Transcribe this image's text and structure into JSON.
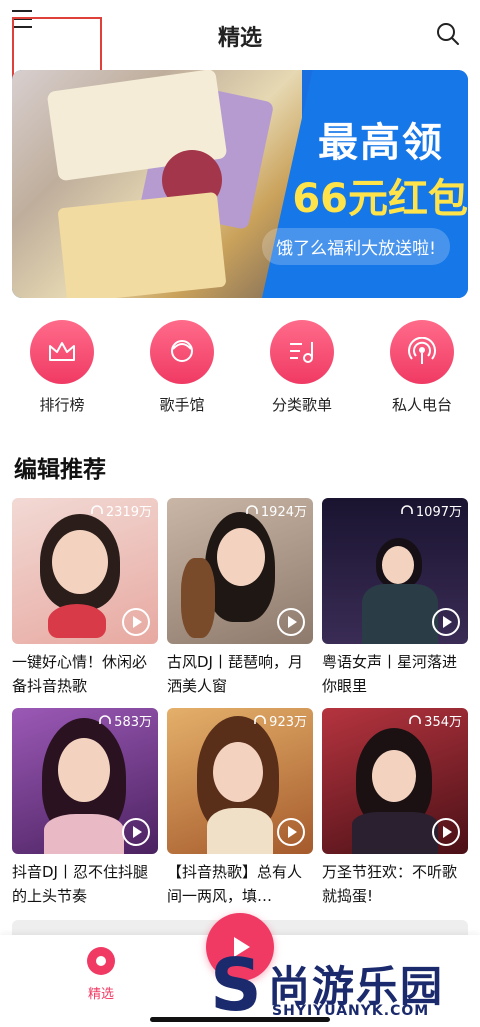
{
  "header": {
    "title": "精选",
    "menu_icon": "menu-icon",
    "search_icon": "search-icon"
  },
  "banner": {
    "line1": "最高领",
    "line2": "66元红包",
    "pill": "饿了么福利大放送啦!",
    "dots_count": 7,
    "active_dot": 0
  },
  "entries": [
    {
      "label": "排行榜",
      "icon": "crown-icon"
    },
    {
      "label": "歌手馆",
      "icon": "singer-icon"
    },
    {
      "label": "分类歌单",
      "icon": "playlist-icon"
    },
    {
      "label": "私人电台",
      "icon": "radio-icon"
    }
  ],
  "section_title": "编辑推荐",
  "cards": [
    {
      "plays": "2319万",
      "title": "一键好心情！休闲必备抖音热歌",
      "bg": "#e9c6c2"
    },
    {
      "plays": "1924万",
      "title": "古风DJ丨琵琶响，月洒美人窗",
      "bg": "#b9a598"
    },
    {
      "plays": "1097万",
      "title": "粤语女声丨星河落进你眼里",
      "bg": "#2c2240"
    },
    {
      "plays": "583万",
      "title": "抖音DJ丨忍不住抖腿的上头节奏",
      "bg": "#7c3d8e"
    },
    {
      "plays": "923万",
      "title": "【抖音热歌】总有人间一两风，填…",
      "bg": "#c78a4e"
    },
    {
      "plays": "354万",
      "title": "万圣节狂欢：不听歌就捣蛋!",
      "bg": "#7b2530"
    }
  ],
  "bottom": {
    "home_label": "精选"
  },
  "watermark": {
    "cn": "尚游乐园",
    "en": "SHYIYUANYK.COM",
    "s": "S"
  }
}
